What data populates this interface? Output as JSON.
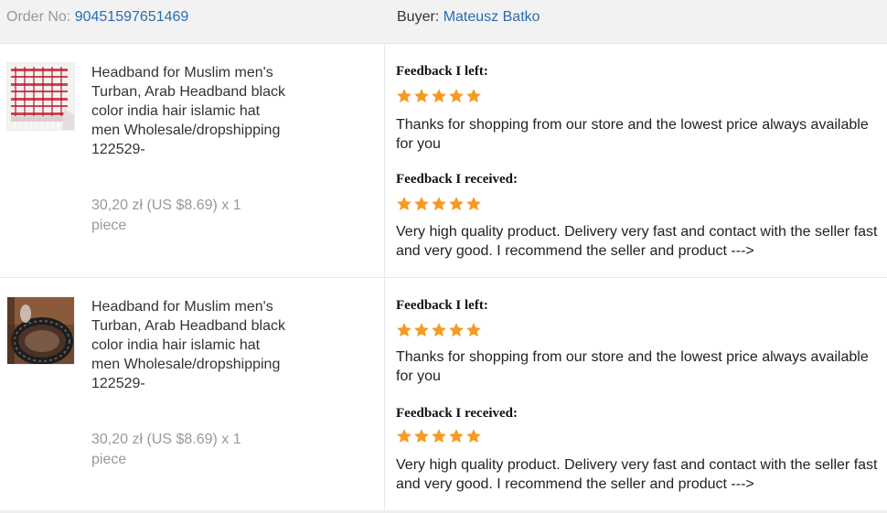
{
  "header": {
    "order_label": "Order No:",
    "order_number": "90451597651469",
    "buyer_label": "Buyer:",
    "buyer_name": "Mateusz Batko"
  },
  "colors": {
    "link": "#2b6cb0",
    "star": "#f59a23",
    "header_bg": "#f2f2f2"
  },
  "orders": [
    {
      "image": "red-white-keffiyeh-scarf-photo",
      "title": "Headband for Muslim men's Turban, Arab Headband black color india hair islamic hat men Wholesale/dropshipping 122529-",
      "price": "30,20 zł (US $8.69) x 1 piece",
      "feedback_left_heading": "Feedback I left:",
      "feedback_left_stars": 5,
      "feedback_left_text": "Thanks for shopping from our store and the lowest price always available for you",
      "feedback_received_heading": "Feedback I received:",
      "feedback_received_stars": 5,
      "feedback_received_text": "Very high quality product. Delivery very fast and contact with the seller fast and very good. I recommend the seller and product --->"
    },
    {
      "image": "black-headband-ring-photo",
      "title": "Headband for Muslim men's Turban, Arab Headband black color india hair islamic hat men Wholesale/dropshipping 122529-",
      "price": "30,20 zł (US $8.69) x 1 piece",
      "feedback_left_heading": "Feedback I left:",
      "feedback_left_stars": 5,
      "feedback_left_text": "Thanks for shopping from our store and the lowest price always available for you",
      "feedback_received_heading": "Feedback I received:",
      "feedback_received_stars": 5,
      "feedback_received_text": "Very high quality product. Delivery very fast and contact with the seller fast and very good. I recommend the seller and product --->"
    }
  ]
}
